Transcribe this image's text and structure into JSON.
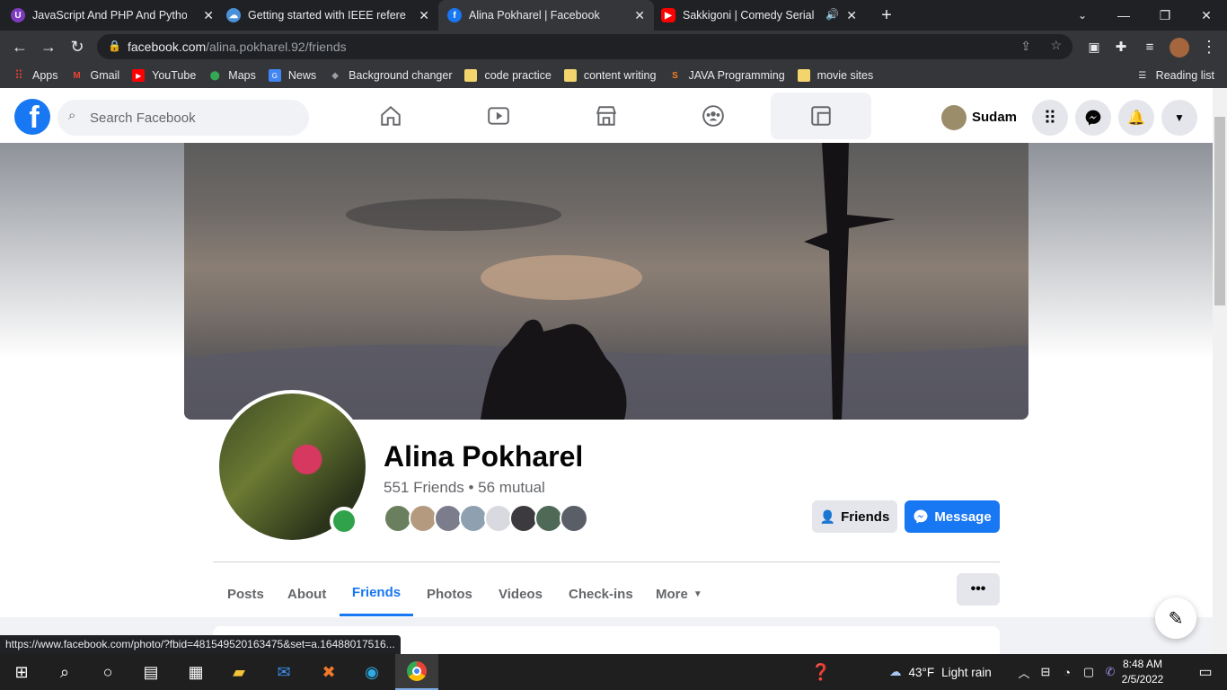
{
  "browser": {
    "tabs": [
      {
        "title": "JavaScript And PHP And Python I",
        "favicon": "u-icon",
        "color": "#7d3cbe"
      },
      {
        "title": "Getting started with IEEE referen",
        "favicon": "cloud-icon",
        "color": "#4a90d9"
      },
      {
        "title": "Alina Pokharel | Facebook",
        "favicon": "facebook-icon",
        "color": "#1877f2"
      },
      {
        "title": "Sakkigoni | Comedy Serial | S",
        "favicon": "youtube-icon",
        "color": "#ff0000"
      }
    ],
    "url_domain": "facebook.com",
    "url_path": "/alina.pokharel.92/friends",
    "bookmarks": [
      "Apps",
      "Gmail",
      "YouTube",
      "Maps",
      "News",
      "Background changer",
      "code practice",
      "content writing",
      "JAVA Programming",
      "movie sites"
    ],
    "reading_list": "Reading list"
  },
  "fb": {
    "logo": "f",
    "search_placeholder": "Search Facebook",
    "user_name": "Sudam"
  },
  "profile": {
    "name": "Alina Pokharel",
    "friends_line": "551 Friends • 56 mutual",
    "friends_button": "Friends",
    "message_button": "Message",
    "tabs": [
      "Posts",
      "About",
      "Friends",
      "Photos",
      "Videos",
      "Check-ins",
      "More"
    ],
    "active_tab": "Friends",
    "more_label": "•••"
  },
  "status_url": "https://www.facebook.com/photo/?fbid=481549520163475&set=a.16488017516...",
  "taskbar": {
    "temperature": "43°F",
    "weather": "Light rain",
    "time": "8:48 AM",
    "date": "2/5/2022"
  },
  "colors": {
    "fb_blue": "#1877f2",
    "online_green": "#31a24c"
  }
}
